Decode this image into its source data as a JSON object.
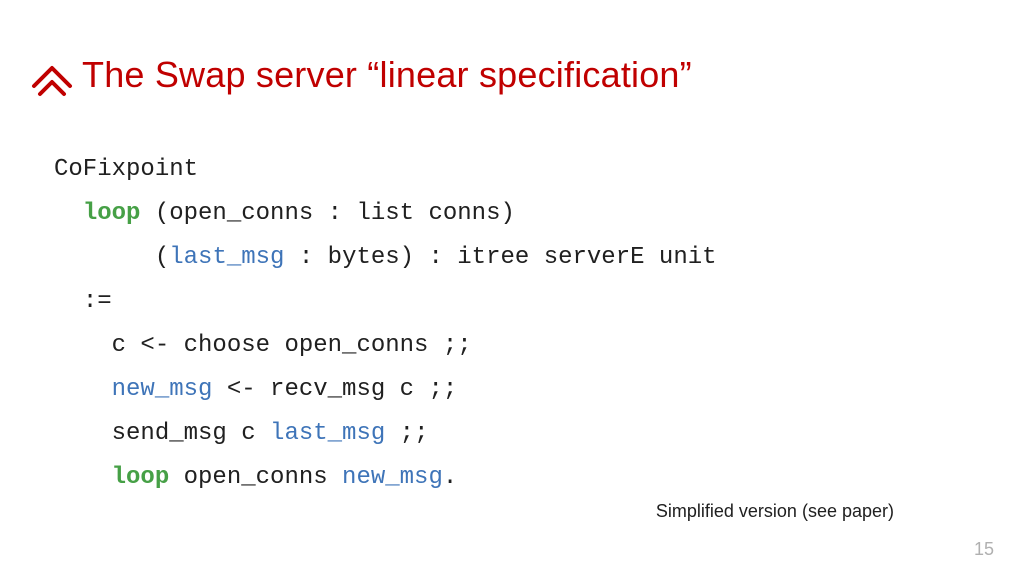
{
  "colors": {
    "accent_red": "#C00000",
    "code_green": "#46A046",
    "code_blue": "#3E74B8",
    "page_number_gray": "#B0B0B0"
  },
  "title": "The Swap server “linear specification”",
  "code": {
    "line1": "CoFixpoint",
    "line2_kw": "loop",
    "line2_rest": " (open_conns : list conns)",
    "line3_pre": "(",
    "line3_var": "last_msg",
    "line3_rest": " : bytes) : itree serverE unit",
    "line4": ":=",
    "line5": "c <- choose open_conns ;;",
    "line6_var": "new_msg",
    "line6_rest": " <- recv_msg c ;;",
    "line7_pre": "send_msg c ",
    "line7_var": "last_msg",
    "line7_post": " ;;",
    "line8_kw": "loop",
    "line8_mid": " open_conns ",
    "line8_var": "new_msg",
    "line8_end": "."
  },
  "footnote": "Simplified version (see paper)",
  "page_number": "15"
}
